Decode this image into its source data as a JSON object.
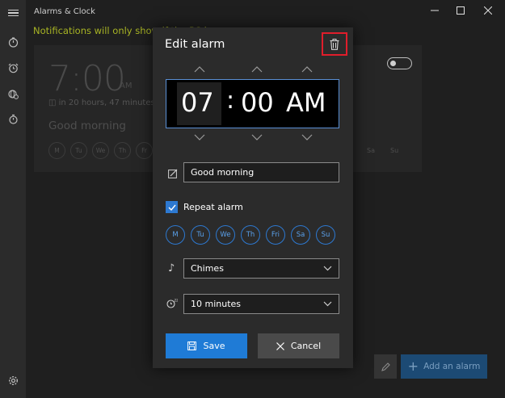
{
  "window": {
    "title": "Alarms & Clock",
    "controls": [
      "minimize",
      "maximize",
      "close"
    ]
  },
  "sidebar": {
    "icons": [
      "hamburger-icon",
      "timer-icon",
      "alarm-icon",
      "world-clock-icon",
      "stopwatch-icon",
      "settings-icon"
    ]
  },
  "notification": {
    "text": "Notifications will only show if the PC is awake"
  },
  "alarm_card": {
    "time": "7:00",
    "ampm": "AM",
    "remaining": "in 20 hours, 47 minutes",
    "name": "Good morning",
    "days": [
      "M",
      "Tu",
      "We",
      "Th",
      "Fr"
    ],
    "days_right": [
      "Sa",
      "Su"
    ]
  },
  "dialog": {
    "title": "Edit alarm",
    "time": {
      "hour": "07",
      "separator": ":",
      "minute": "00",
      "period": "AM"
    },
    "alarm_name": "Good morning",
    "repeat_label": "Repeat alarm",
    "repeat_checked": true,
    "days": [
      "M",
      "Tu",
      "We",
      "Th",
      "Fri",
      "Sa",
      "Su"
    ],
    "sound": "Chimes",
    "snooze": "10 minutes",
    "save_label": "Save",
    "cancel_label": "Cancel"
  },
  "bottom_bar": {
    "add_label": "Add an alarm"
  },
  "colors": {
    "accent": "#1f7bd6",
    "highlight": "#e01d2b",
    "notification": "#a8b424"
  }
}
